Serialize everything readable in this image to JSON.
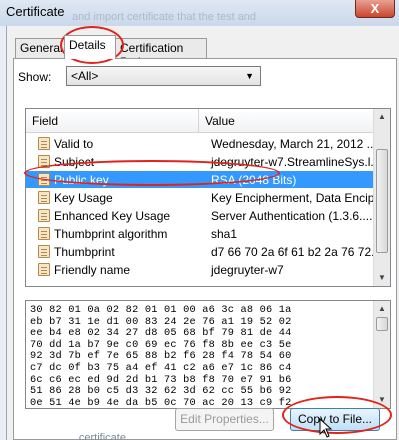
{
  "window": {
    "title": "Certificate",
    "close_label": "X",
    "background_text": "and import certificate that the test and",
    "bottom_text": "... ... ... ... certificate..."
  },
  "tabs": [
    {
      "label": "General"
    },
    {
      "label": "Details"
    },
    {
      "label": "Certification Path"
    }
  ],
  "show": {
    "label": "Show:",
    "selected": "<All>"
  },
  "list": {
    "columns": [
      "Field",
      "Value"
    ],
    "rows": [
      {
        "field": "Valid to",
        "value": "Wednesday, March 21, 2012 ..."
      },
      {
        "field": "Subject",
        "value": "jdegruyter-w7.StreamlineSys.l..."
      },
      {
        "field": "Public key",
        "value": "RSA (2048 Bits)"
      },
      {
        "field": "Key Usage",
        "value": "Key Encipherment, Data Encip..."
      },
      {
        "field": "Enhanced Key Usage",
        "value": "Server Authentication (1.3.6...."
      },
      {
        "field": "Thumbprint algorithm",
        "value": "sha1"
      },
      {
        "field": "Thumbprint",
        "value": "d7 66 70 2a 6f 61 b2 2a 76 72..."
      },
      {
        "field": "Friendly name",
        "value": "jdegruyter-w7"
      }
    ],
    "selected_index": 2
  },
  "hex": {
    "lines": [
      "30 82 01 0a 02 82 01 01 00 a6 3c a8 06 1a",
      "eb b7 31 1e d1 00 83 24 2e 76 a1 19 52 02",
      "ee b4 e8 02 34 27 d8 05 68 bf 79 81 de 44",
      "70 dd 1a b7 9e c0 69 ec 76 f8 8b ee c3 5e",
      "92 3d 7b ef 7e 65 88 b2 f6 28 f4 78 54 60",
      "c7 dc 0f b3 75 a4 ef 41 c2 a6 e7 1c 86 c4",
      "6c c6 ec ed 9d 2d b1 73 b8 f8 70 e7 91 b6",
      "51 86 28 b0 c5 d3 32 62 3d 62 cc 55 b6 92",
      "0e 51 4e b9 4e da b5 0c 70 ac 20 13 c9 f2"
    ]
  },
  "buttons": {
    "edit_properties": "Edit Properties...",
    "copy_to_file": "Copy to File..."
  },
  "colors": {
    "selection": "#3399ff",
    "highlight_oval": "#e2231a"
  }
}
